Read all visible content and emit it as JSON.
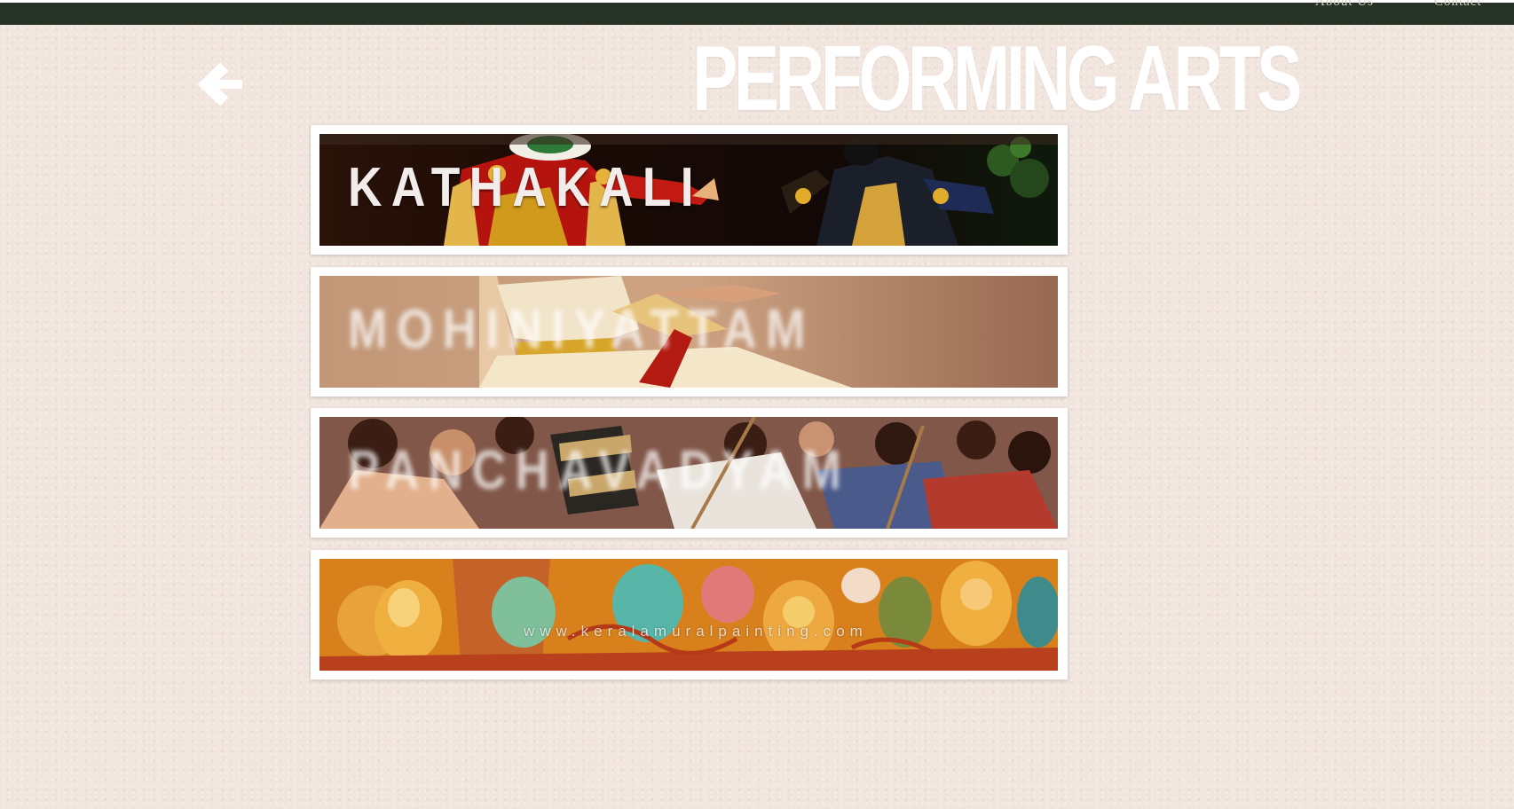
{
  "topbar": {
    "nav": {
      "about_label": "About Us",
      "contact_label": "Contact"
    }
  },
  "header": {
    "back_icon": "arrow-left-icon",
    "title": "PERFORMING ARTS"
  },
  "cards": [
    {
      "id": "kathakali",
      "title": "KATHAKALI",
      "state": "focused"
    },
    {
      "id": "mohiniyattam",
      "title": "MOHINIYATTAM",
      "state": "faded"
    },
    {
      "id": "panchavadyam",
      "title": "PANCHAVADYAM",
      "state": "faded"
    },
    {
      "id": "mural",
      "title": "",
      "watermark": "www.keralamuralpainting.com",
      "state": "faded"
    }
  ],
  "colors": {
    "topbar": "#263226",
    "background": "#f1e5de",
    "title": "#ffffff",
    "card_frame": "#ffffff"
  }
}
